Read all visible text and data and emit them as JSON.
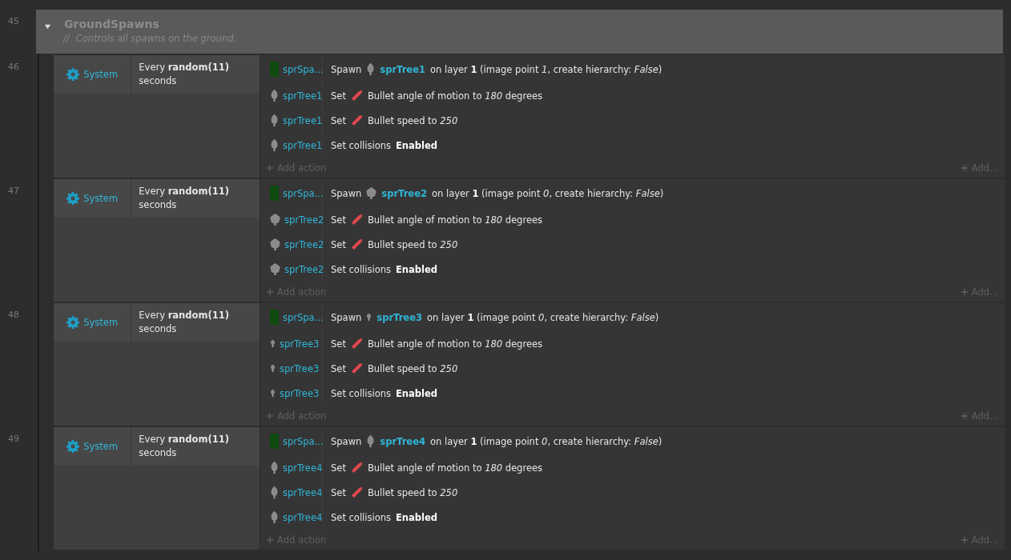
{
  "group": {
    "line": "45",
    "expanded": true,
    "title": "GroundSpawns",
    "comment_mark": "//",
    "comment": "Controls all spawns on the ground."
  },
  "events": [
    {
      "line": "46",
      "condition": {
        "object": "System",
        "text": "Every **random(11)** seconds"
      },
      "actions": [
        {
          "object": {
            "kind": "sprite",
            "name": "sprSpa..."
          },
          "verb": "Spawn",
          "icon": {
            "kind": "leaf-tree"
          },
          "target": "sprTree1",
          "text": "on layer **1** (image point *1*, create hierarchy: *False*)"
        },
        {
          "object": {
            "kind": "leaf-tree",
            "name": "sprTree1"
          },
          "verb": "Set",
          "icon": {
            "kind": "bullet"
          },
          "text": "Bullet angle of motion to *180* degrees"
        },
        {
          "object": {
            "kind": "leaf-tree",
            "name": "sprTree1"
          },
          "verb": "Set",
          "icon": {
            "kind": "bullet"
          },
          "text": "Bullet speed to *250*"
        },
        {
          "object": {
            "kind": "leaf-tree",
            "name": "sprTree1"
          },
          "verb": "Set collisions",
          "text": "**Enabled**"
        }
      ],
      "add_action": "Add action",
      "add_more": "Add..."
    },
    {
      "line": "47",
      "condition": {
        "object": "System",
        "text": "Every **random(11)** seconds"
      },
      "actions": [
        {
          "object": {
            "kind": "sprite",
            "name": "sprSpa..."
          },
          "verb": "Spawn",
          "icon": {
            "kind": "bushy-tree"
          },
          "target": "sprTree2",
          "text": "on layer **1** (image point *0*, create hierarchy: *False*)"
        },
        {
          "object": {
            "kind": "bushy-tree",
            "name": "sprTree2"
          },
          "verb": "Set",
          "icon": {
            "kind": "bullet"
          },
          "text": "Bullet angle of motion to *180* degrees"
        },
        {
          "object": {
            "kind": "bushy-tree",
            "name": "sprTree2"
          },
          "verb": "Set",
          "icon": {
            "kind": "bullet"
          },
          "text": "Bullet speed to *250*"
        },
        {
          "object": {
            "kind": "bushy-tree",
            "name": "sprTree2"
          },
          "verb": "Set collisions",
          "text": "**Enabled**"
        }
      ],
      "add_action": "Add action",
      "add_more": "Add..."
    },
    {
      "line": "48",
      "condition": {
        "object": "System",
        "text": "Every **random(11)** seconds"
      },
      "actions": [
        {
          "object": {
            "kind": "sprite",
            "name": "sprSpa..."
          },
          "verb": "Spawn",
          "icon": {
            "kind": "small-tree"
          },
          "target": "sprTree3",
          "text": "on layer **1** (image point *0*, create hierarchy: *False*)"
        },
        {
          "object": {
            "kind": "small-tree",
            "name": "sprTree3"
          },
          "verb": "Set",
          "icon": {
            "kind": "bullet"
          },
          "text": "Bullet angle of motion to *180* degrees"
        },
        {
          "object": {
            "kind": "small-tree",
            "name": "sprTree3"
          },
          "verb": "Set",
          "icon": {
            "kind": "bullet"
          },
          "text": "Bullet speed to *250*"
        },
        {
          "object": {
            "kind": "small-tree",
            "name": "sprTree3"
          },
          "verb": "Set collisions",
          "text": "**Enabled**"
        }
      ],
      "add_action": "Add action",
      "add_more": "Add..."
    },
    {
      "line": "49",
      "condition": {
        "object": "System",
        "text": "Every **random(11)** seconds"
      },
      "actions": [
        {
          "object": {
            "kind": "sprite",
            "name": "sprSpa..."
          },
          "verb": "Spawn",
          "icon": {
            "kind": "leaf-tree"
          },
          "target": "sprTree4",
          "text": "on layer **1** (image point *0*, create hierarchy: *False*)"
        },
        {
          "object": {
            "kind": "leaf-tree",
            "name": "sprTree4"
          },
          "verb": "Set",
          "icon": {
            "kind": "bullet"
          },
          "text": "Bullet angle of motion to *180* degrees"
        },
        {
          "object": {
            "kind": "leaf-tree",
            "name": "sprTree4"
          },
          "verb": "Set",
          "icon": {
            "kind": "bullet"
          },
          "text": "Bullet speed to *250*"
        },
        {
          "object": {
            "kind": "leaf-tree",
            "name": "sprTree4"
          },
          "verb": "Set collisions",
          "text": "**Enabled**"
        }
      ],
      "add_action": "Add action",
      "add_more": "Add..."
    }
  ]
}
